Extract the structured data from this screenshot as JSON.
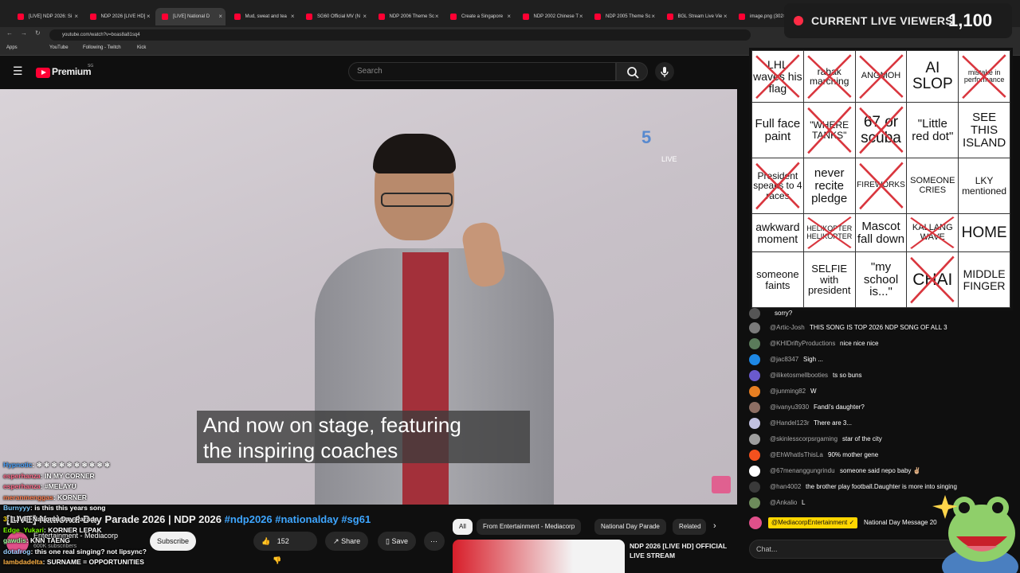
{
  "browser": {
    "tabs": [
      {
        "label": "[LIVE] NDP 2026: Si"
      },
      {
        "label": "NDP 2026 [LIVE HD]"
      },
      {
        "label": "[LIVE] National D"
      },
      {
        "label": "Mud, sweat and tea"
      },
      {
        "label": "SG60 Official MV (N"
      },
      {
        "label": "NDP 2006 Theme Sc"
      },
      {
        "label": "Create a Singapore"
      },
      {
        "label": "NDP 2002 Chinese T"
      },
      {
        "label": "NDP 2005 Theme Sc"
      },
      {
        "label": "BGL Stream Live Vie"
      },
      {
        "label": "image.png (302×45)"
      }
    ],
    "url": "youtube.com/watch?v=boas8a81sq4",
    "bookmarks": [
      "Apps",
      "YouTube",
      "Following - Twitch",
      "Kick"
    ]
  },
  "youtube": {
    "logo": "Premium",
    "logo_badge": "SG",
    "search_placeholder": "Search",
    "channel_logo": "5",
    "live_label": "LIVE",
    "caption_line1": "And now on stage, featuring",
    "caption_line2": "the inspiring coaches",
    "video_title": "[LIVE] National Day Parade 2026 | NDP 2026",
    "video_tags": "#ndp2026 #nationalday #sg61",
    "channel_name": "Entertainment - Mediacorp",
    "subscribers": "600K subscribers",
    "subscribe_label": "Subscribe",
    "likes": "152",
    "share_label": "Share",
    "save_label": "Save",
    "chips": [
      "All",
      "From Entertainment - Mediacorp",
      "National Day Parade",
      "Related"
    ],
    "related_title": "NDP 2026 [LIVE HD] OFFICIAL LIVE STREAM"
  },
  "overlay_chat": [
    {
      "user": "Hypnotic",
      "text": "❄ ❄ ❄ ❄ ❄ ❄ ❄ ❄ ❄ ❄",
      "color": "#4aa3ff"
    },
    {
      "user": "esperhanza",
      "text": "IN MY CORNER",
      "color": "#ff6b8a"
    },
    {
      "user": "esperhanza",
      "text": "#MELAYU",
      "color": "#ff6b8a"
    },
    {
      "user": "meranmenggas",
      "text": "KORNER",
      "color": "#ff7f50"
    },
    {
      "user": "Burnyyy",
      "text": "is this this years song",
      "color": "#7ecbff"
    },
    {
      "user": "3",
      "text": "[LIVE] National Day Parade",
      "color": "#ffd700"
    },
    {
      "user": "Edge_Yukari",
      "text": "KORNER LEPAK",
      "color": "#7cfc00"
    },
    {
      "user": "gawdis",
      "text": "KNN TAENG",
      "color": "#a0ffa0"
    },
    {
      "user": "dotafrog",
      "text": "this one real singing? not lipsync?",
      "color": "#9ad0ff"
    },
    {
      "user": "lambdadelta",
      "text": "SURNAME = OPPORTUNITIES",
      "color": "#ffb347"
    }
  ],
  "viewers": {
    "label": "CURRENT LIVE VIEWERS",
    "count": "1,100"
  },
  "bingo": [
    [
      {
        "t": "LHL waves his flag",
        "x": true,
        "fs": 14
      },
      {
        "t": "rabak marching",
        "x": true,
        "fs": 12
      },
      {
        "t": "ANGMOH",
        "x": true,
        "fs": 11
      },
      {
        "t": "AI SLOP",
        "x": false,
        "fs": 19
      },
      {
        "t": "mistake in performance",
        "x": true,
        "fs": 9
      }
    ],
    [
      {
        "t": "Full face paint",
        "x": false,
        "fs": 15
      },
      {
        "t": "\"WHERE TANKS\"",
        "x": true,
        "fs": 12
      },
      {
        "t": "67 or scuba",
        "x": true,
        "fs": 19
      },
      {
        "t": "\"Little red dot\"",
        "x": false,
        "fs": 15
      },
      {
        "t": "SEE THIS ISLAND",
        "x": false,
        "fs": 15
      }
    ],
    [
      {
        "t": "President speaks to 4 races",
        "x": true,
        "fs": 12
      },
      {
        "t": "never recite pledge",
        "x": false,
        "fs": 15
      },
      {
        "t": "FIREWORKS",
        "x": true,
        "fs": 10
      },
      {
        "t": "SOMEONE CRIES",
        "x": false,
        "fs": 11
      },
      {
        "t": "LKY mentioned",
        "x": false,
        "fs": 12
      }
    ],
    [
      {
        "t": "awkward moment",
        "x": false,
        "fs": 14
      },
      {
        "t": "HELIKOPTER HELIKOPTER",
        "x": true,
        "fs": 9
      },
      {
        "t": "Mascot fall down",
        "x": false,
        "fs": 15
      },
      {
        "t": "KALLANG WAVE",
        "x": true,
        "fs": 11
      },
      {
        "t": "HOME",
        "x": false,
        "fs": 19
      }
    ],
    [
      {
        "t": "someone faints",
        "x": false,
        "fs": 13
      },
      {
        "t": "SELFIE with president",
        "x": false,
        "fs": 13
      },
      {
        "t": "\"my school is...\"",
        "x": false,
        "fs": 15
      },
      {
        "t": "CHAI",
        "x": true,
        "fs": 21
      },
      {
        "t": "MIDDLE FINGER",
        "x": false,
        "fs": 14
      }
    ]
  ],
  "yt_chat": [
    {
      "user": "",
      "text": "sorry?",
      "avatar": "#555"
    },
    {
      "user": "@Artic-Josh",
      "text": "THIS SONG IS TOP 2026 NDP SONG OF ALL 3",
      "avatar": "#7a7a7a"
    },
    {
      "user": "@KHIDriftyProductions",
      "text": "nice nice nice",
      "avatar": "#5a7a5a"
    },
    {
      "user": "@jac8347",
      "text": "Sigh ...",
      "avatar": "#1e88e5"
    },
    {
      "user": "@iliketosmellbooties",
      "text": "ts so buns",
      "avatar": "#6a5acd"
    },
    {
      "user": "@junming82",
      "text": "W",
      "avatar": "#e67e22"
    },
    {
      "user": "@ivanyu3930",
      "text": "Fandi's daughter?",
      "avatar": "#8d6e63"
    },
    {
      "user": "@Handel123r",
      "text": "There are 3...",
      "avatar": "#c0c0e0"
    },
    {
      "user": "@skinlesscorpsrgaming",
      "text": "star of the city",
      "avatar": "#9e9e9e"
    },
    {
      "user": "@EhWhatIsThisLa",
      "text": "90% mother gene",
      "avatar": "#f4511e"
    },
    {
      "user": "@67menanggungrindu",
      "text": "someone said nepo baby ✌🏼",
      "avatar": "#ffffff"
    },
    {
      "user": "@han4002",
      "text": "the brother play football.Daughter is more into singing",
      "avatar": "#3a3a3a"
    },
    {
      "user": "@Ankalio",
      "text": "L",
      "avatar": "#6d8b5b"
    }
  ],
  "pinned": {
    "badge": "@MediacorpEntertainment ✓",
    "text": "National Day Message 20"
  },
  "chat_placeholder": "Chat..."
}
